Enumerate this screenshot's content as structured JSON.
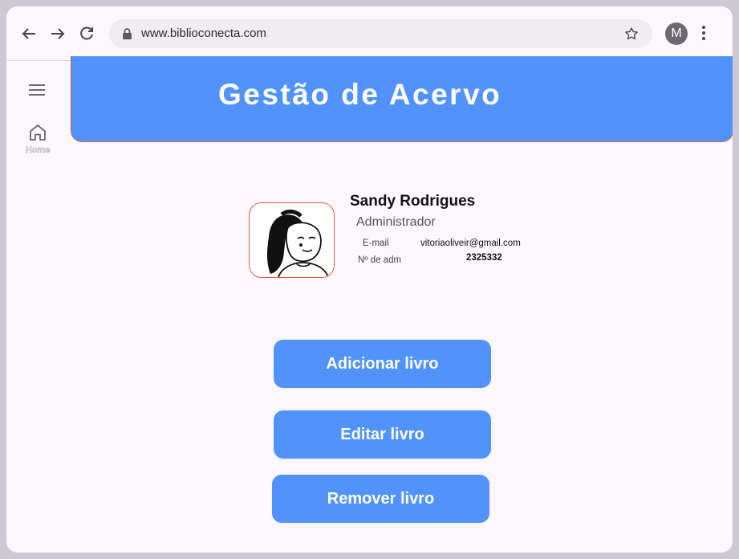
{
  "browser": {
    "url": "www.biblioconecta.com",
    "profile_initial": "M"
  },
  "sidebar": {
    "home_label": "Home"
  },
  "header": {
    "title": "Gestão de Acervo",
    "color": "#5192fd",
    "border_color": "#e05a44"
  },
  "profile": {
    "name": "Sandy Rodrigues",
    "role": "Administrador",
    "email_label": "E-mail",
    "email_value": "vitoriaoliveir@gmail.com",
    "adm_label": "Nº de adm",
    "adm_value": "2325332"
  },
  "actions": {
    "add_label": "Adicionar livro",
    "edit_label": "Editar livro",
    "remove_label": "Remover livro"
  },
  "icons": [
    "back-icon",
    "forward-icon",
    "reload-icon",
    "lock-icon",
    "star-icon",
    "more-vert-icon",
    "hamburger-menu-icon",
    "home-icon"
  ]
}
